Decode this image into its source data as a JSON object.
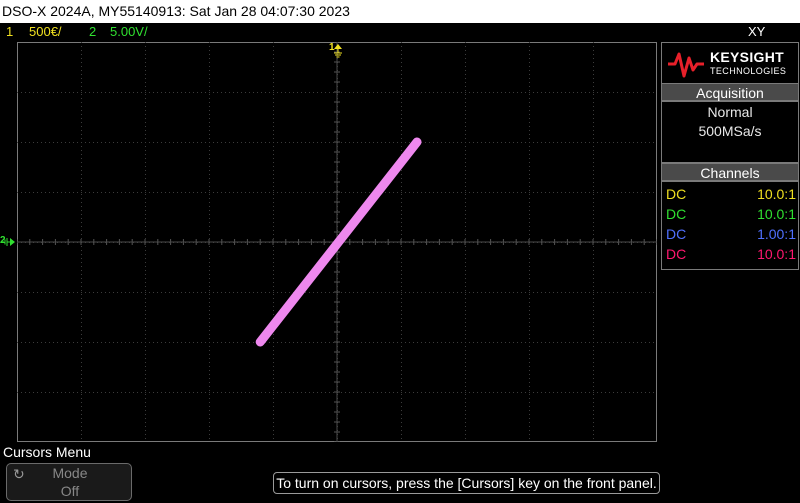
{
  "title": "DSO-X 2024A, MY55140913: Sat Jan 28 04:07:30 2023",
  "status": {
    "ch1_num": "1",
    "ch1_scale": "500€/",
    "ch2_num": "2",
    "ch2_scale": "5.00V/",
    "mode": "XY"
  },
  "markers": {
    "top_marker": "1",
    "left_marker": "2"
  },
  "brand": {
    "name": "KEYSIGHT",
    "sub": "TECHNOLOGIES"
  },
  "acquisition": {
    "header": "Acquisition",
    "mode": "Normal",
    "rate": "500MSa/s"
  },
  "channels": {
    "header": "Channels",
    "rows": [
      {
        "coupling": "DC",
        "ratio": "10.0:1",
        "color": "#f0e020"
      },
      {
        "coupling": "DC",
        "ratio": "10.0:1",
        "color": "#30e030"
      },
      {
        "coupling": "DC",
        "ratio": "1.00:1",
        "color": "#5070ff"
      },
      {
        "coupling": "DC",
        "ratio": "10.0:1",
        "color": "#ff1870"
      }
    ]
  },
  "softkeys": {
    "menu_title": "Cursors Menu",
    "mode_label": "Mode",
    "mode_value": "Off"
  },
  "hint": "To turn on cursors, press the [Cursors] key on the front panel.",
  "colors": {
    "ch1": "#f0e020",
    "ch2": "#30e030",
    "trace": "#ee88ee",
    "grid": "#3c3c3c"
  },
  "trace": {
    "x_start_div": -1.2,
    "y_start_div": -2.0,
    "x_end_div": 1.25,
    "y_end_div": 2.0
  }
}
